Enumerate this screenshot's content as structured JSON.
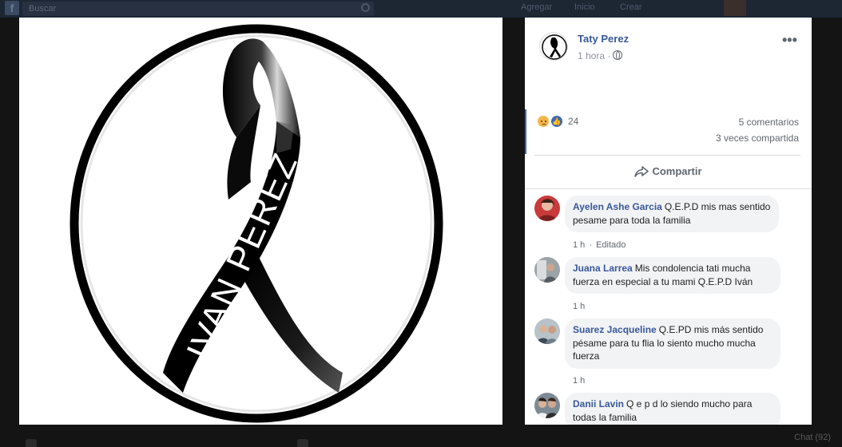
{
  "topbar": {
    "logo_glyph": "f",
    "search_placeholder": "Buscar",
    "links": [
      "Agregar",
      "Inicio",
      "Crear"
    ]
  },
  "photo": {
    "ribbon_text": "IVAN PEREZ"
  },
  "post": {
    "author": "Taty Perez",
    "time": "1 hora",
    "time_separator": "·",
    "privacy_icon": "globe-icon",
    "more_icon": "more-options-icon",
    "reaction_count": "24",
    "reactions": [
      "sad-reaction-icon",
      "like-reaction-icon"
    ],
    "comments_count": "5 comentarios",
    "shares_count": "3 veces compartida",
    "share_label": "Compartir"
  },
  "comments": [
    {
      "name": "Ayelen Ashe Garcia",
      "text": "Q.E.P.D mis mas sentido pesame para toda la familia",
      "time": "1 h",
      "edited": "Editado"
    },
    {
      "name": "Juana Larrea",
      "text": "Mis condolencia tati mucha fuerza en especial a tu mami Q.E.P.D Iván",
      "time": "1 h",
      "edited": ""
    },
    {
      "name": "Suarez Jacqueline",
      "text": "Q.E.PD mis más sentido pésame para tu flia lo siento mucho mucha fuerza",
      "time": "1 h",
      "edited": ""
    },
    {
      "name": "Danii Lavin",
      "text": "Q e p d lo siendo mucho para todas la familia",
      "time": "",
      "edited": ""
    }
  ],
  "bottombar": {
    "chat_label": "Chat (92)"
  },
  "colors": {
    "accent": "#4267b2",
    "link": "#385898",
    "background": "#141414"
  }
}
